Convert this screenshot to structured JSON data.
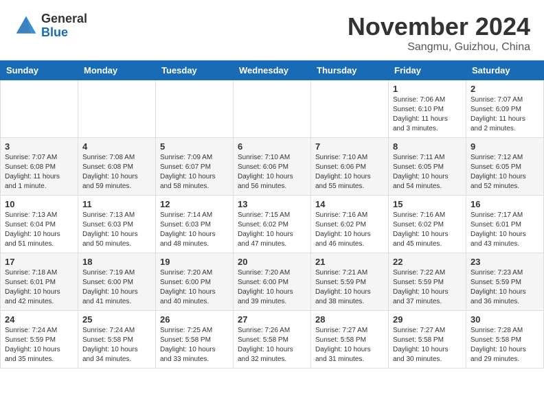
{
  "header": {
    "logo_general": "General",
    "logo_blue": "Blue",
    "month_title": "November 2024",
    "location": "Sangmu, Guizhou, China"
  },
  "weekdays": [
    "Sunday",
    "Monday",
    "Tuesday",
    "Wednesday",
    "Thursday",
    "Friday",
    "Saturday"
  ],
  "weeks": [
    [
      {
        "day": "",
        "info": ""
      },
      {
        "day": "",
        "info": ""
      },
      {
        "day": "",
        "info": ""
      },
      {
        "day": "",
        "info": ""
      },
      {
        "day": "",
        "info": ""
      },
      {
        "day": "1",
        "info": "Sunrise: 7:06 AM\nSunset: 6:10 PM\nDaylight: 11 hours\nand 3 minutes."
      },
      {
        "day": "2",
        "info": "Sunrise: 7:07 AM\nSunset: 6:09 PM\nDaylight: 11 hours\nand 2 minutes."
      }
    ],
    [
      {
        "day": "3",
        "info": "Sunrise: 7:07 AM\nSunset: 6:08 PM\nDaylight: 11 hours\nand 1 minute."
      },
      {
        "day": "4",
        "info": "Sunrise: 7:08 AM\nSunset: 6:08 PM\nDaylight: 10 hours\nand 59 minutes."
      },
      {
        "day": "5",
        "info": "Sunrise: 7:09 AM\nSunset: 6:07 PM\nDaylight: 10 hours\nand 58 minutes."
      },
      {
        "day": "6",
        "info": "Sunrise: 7:10 AM\nSunset: 6:06 PM\nDaylight: 10 hours\nand 56 minutes."
      },
      {
        "day": "7",
        "info": "Sunrise: 7:10 AM\nSunset: 6:06 PM\nDaylight: 10 hours\nand 55 minutes."
      },
      {
        "day": "8",
        "info": "Sunrise: 7:11 AM\nSunset: 6:05 PM\nDaylight: 10 hours\nand 54 minutes."
      },
      {
        "day": "9",
        "info": "Sunrise: 7:12 AM\nSunset: 6:05 PM\nDaylight: 10 hours\nand 52 minutes."
      }
    ],
    [
      {
        "day": "10",
        "info": "Sunrise: 7:13 AM\nSunset: 6:04 PM\nDaylight: 10 hours\nand 51 minutes."
      },
      {
        "day": "11",
        "info": "Sunrise: 7:13 AM\nSunset: 6:03 PM\nDaylight: 10 hours\nand 50 minutes."
      },
      {
        "day": "12",
        "info": "Sunrise: 7:14 AM\nSunset: 6:03 PM\nDaylight: 10 hours\nand 48 minutes."
      },
      {
        "day": "13",
        "info": "Sunrise: 7:15 AM\nSunset: 6:02 PM\nDaylight: 10 hours\nand 47 minutes."
      },
      {
        "day": "14",
        "info": "Sunrise: 7:16 AM\nSunset: 6:02 PM\nDaylight: 10 hours\nand 46 minutes."
      },
      {
        "day": "15",
        "info": "Sunrise: 7:16 AM\nSunset: 6:02 PM\nDaylight: 10 hours\nand 45 minutes."
      },
      {
        "day": "16",
        "info": "Sunrise: 7:17 AM\nSunset: 6:01 PM\nDaylight: 10 hours\nand 43 minutes."
      }
    ],
    [
      {
        "day": "17",
        "info": "Sunrise: 7:18 AM\nSunset: 6:01 PM\nDaylight: 10 hours\nand 42 minutes."
      },
      {
        "day": "18",
        "info": "Sunrise: 7:19 AM\nSunset: 6:00 PM\nDaylight: 10 hours\nand 41 minutes."
      },
      {
        "day": "19",
        "info": "Sunrise: 7:20 AM\nSunset: 6:00 PM\nDaylight: 10 hours\nand 40 minutes."
      },
      {
        "day": "20",
        "info": "Sunrise: 7:20 AM\nSunset: 6:00 PM\nDaylight: 10 hours\nand 39 minutes."
      },
      {
        "day": "21",
        "info": "Sunrise: 7:21 AM\nSunset: 5:59 PM\nDaylight: 10 hours\nand 38 minutes."
      },
      {
        "day": "22",
        "info": "Sunrise: 7:22 AM\nSunset: 5:59 PM\nDaylight: 10 hours\nand 37 minutes."
      },
      {
        "day": "23",
        "info": "Sunrise: 7:23 AM\nSunset: 5:59 PM\nDaylight: 10 hours\nand 36 minutes."
      }
    ],
    [
      {
        "day": "24",
        "info": "Sunrise: 7:24 AM\nSunset: 5:59 PM\nDaylight: 10 hours\nand 35 minutes."
      },
      {
        "day": "25",
        "info": "Sunrise: 7:24 AM\nSunset: 5:58 PM\nDaylight: 10 hours\nand 34 minutes."
      },
      {
        "day": "26",
        "info": "Sunrise: 7:25 AM\nSunset: 5:58 PM\nDaylight: 10 hours\nand 33 minutes."
      },
      {
        "day": "27",
        "info": "Sunrise: 7:26 AM\nSunset: 5:58 PM\nDaylight: 10 hours\nand 32 minutes."
      },
      {
        "day": "28",
        "info": "Sunrise: 7:27 AM\nSunset: 5:58 PM\nDaylight: 10 hours\nand 31 minutes."
      },
      {
        "day": "29",
        "info": "Sunrise: 7:27 AM\nSunset: 5:58 PM\nDaylight: 10 hours\nand 30 minutes."
      },
      {
        "day": "30",
        "info": "Sunrise: 7:28 AM\nSunset: 5:58 PM\nDaylight: 10 hours\nand 29 minutes."
      }
    ]
  ]
}
